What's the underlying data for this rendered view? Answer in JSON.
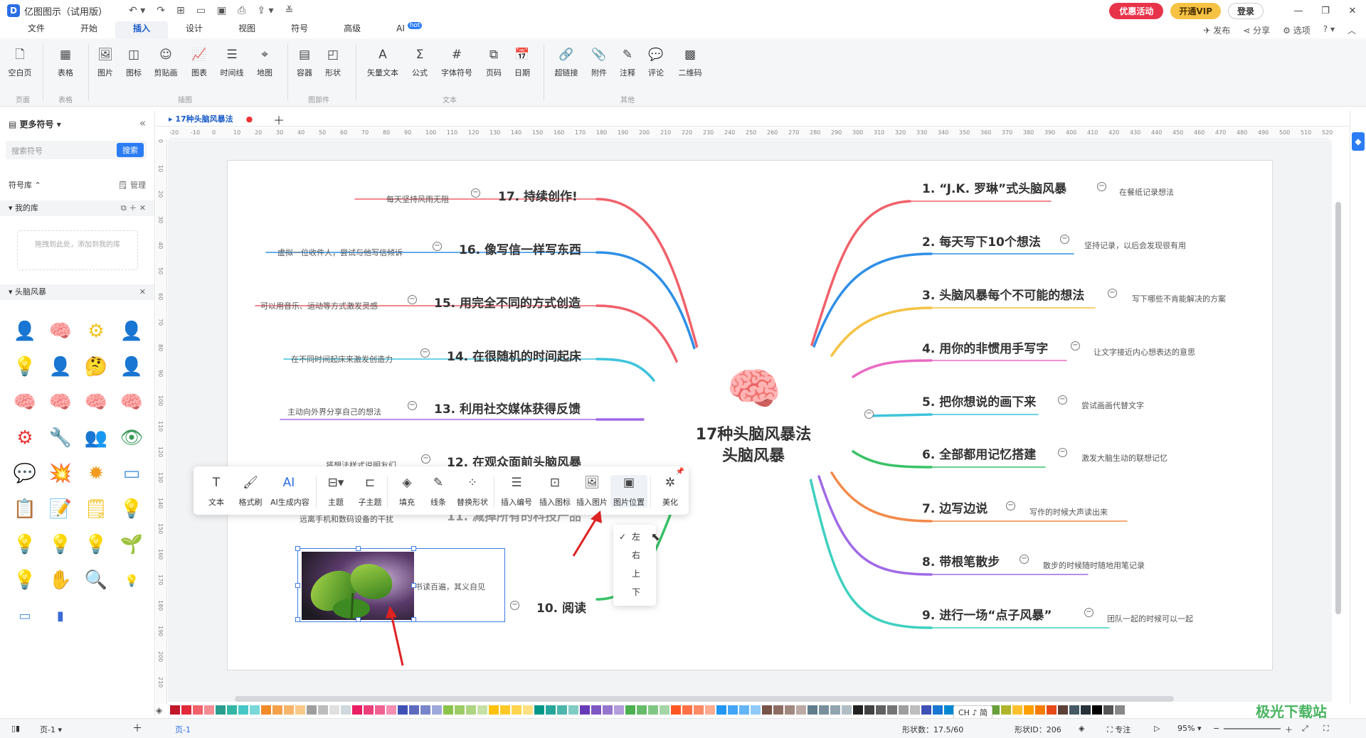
{
  "titlebar": {
    "app_title": "亿图图示（试用版）",
    "promo_label": "优惠活动",
    "vip_label": "开通VIP",
    "login_label": "登录"
  },
  "menu": {
    "tabs": [
      "文件",
      "开始",
      "插入",
      "设计",
      "视图",
      "符号",
      "高级",
      "AI"
    ],
    "ai_badge": "hot",
    "right": [
      "发布",
      "分享",
      "选项"
    ]
  },
  "ribbon": {
    "buttons": [
      "空白页",
      "表格",
      "图片",
      "图标",
      "剪贴画",
      "图表",
      "时间线",
      "地图",
      "容器",
      "形状",
      "矢量文本",
      "公式",
      "字体符号",
      "页码",
      "日期",
      "超链接",
      "附件",
      "注释",
      "评论",
      "二维码"
    ],
    "groups": [
      "页面",
      "表格",
      "插图",
      "图部件",
      "文本",
      "其他"
    ]
  },
  "left_panel": {
    "header": "更多符号",
    "search_placeholder": "搜索符号",
    "search_button": "搜索",
    "library_label": "符号库",
    "manage_label": "管理",
    "my_library": "我的库",
    "drop_hint": "拖拽到此处，添加到我的库",
    "category": "头脑风暴"
  },
  "document": {
    "tab_name": "17种头脑风暴法"
  },
  "mindmap": {
    "central_line1": "17种头脑风暴法",
    "central_line2": "头脑风暴",
    "right_topics": [
      {
        "title": "1. “J.K. 罗琳”式头脑风暴",
        "note": "在餐纸记录想法"
      },
      {
        "title": "2. 每天写下10个想法",
        "note": "坚持记录，以后会发现很有用"
      },
      {
        "title": "3. 头脑风暴每个不可能的想法",
        "note": "写下哪些不肯能解决的方案"
      },
      {
        "title": "4. 用你的非惯用手写字",
        "note": "让文字接近内心想表达的意思"
      },
      {
        "title": "5. 把你想说的画下来",
        "note": "尝试画画代替文字"
      },
      {
        "title": "6. 全部都用记忆搭建",
        "note": "激发大脑生动的联想记忆"
      },
      {
        "title": "7. 边写边说",
        "note": "写作的时候大声读出来"
      },
      {
        "title": "8. 带根笔散步",
        "note": "散步的时候随时随地用笔记录"
      },
      {
        "title": "9. 进行一场“点子风暴”",
        "note": "团队一起的时候可以一起"
      }
    ],
    "left_topics": [
      {
        "title": "17. 持续创作!",
        "note": "每天坚持风雨无阻"
      },
      {
        "title": "16. 像写信一样写东西",
        "note": "虚拟一位收件人，尝试与他写信倾诉"
      },
      {
        "title": "15. 用完全不同的方式创造",
        "note": "可以用音乐、运动等方式激发灵感"
      },
      {
        "title": "14. 在很随机的时间起床",
        "note": "在不同时间起床来激发创造力"
      },
      {
        "title": "13. 利用社交媒体获得反馈",
        "note": "主动向外界分享自己的想法"
      },
      {
        "title": "12. 在观众面前头脑风暴",
        "note": "将想法样式说明友们"
      },
      {
        "title": "11. 减掉所有的科技产品",
        "note": "远离手机和数码设备的干扰"
      },
      {
        "title": "10. 阅读",
        "note": "书读百遍，其义自见"
      }
    ]
  },
  "float_toolbar": {
    "buttons": [
      "文本",
      "格式刷",
      "AI生成内容",
      "主题",
      "子主题",
      "填充",
      "线条",
      "替换形状",
      "插入编号",
      "插入图标",
      "插入图片",
      "图片位置",
      "美化"
    ]
  },
  "dropdown": {
    "items": [
      "左",
      "右",
      "上",
      "下"
    ],
    "selected": "左"
  },
  "statusbar": {
    "page_label": "页-1",
    "page_tab": "页-1",
    "shape_count": "形状数：17.5/60",
    "shape_id": "形状ID：206",
    "focus_label": "专注",
    "zoom": "95%"
  },
  "ime_indicator": "CH ♪ 简",
  "watermark": "极光下载站",
  "colors": {
    "accent": "#2b7cf5",
    "promo": "#e8344a",
    "vip": "#f5c243"
  }
}
